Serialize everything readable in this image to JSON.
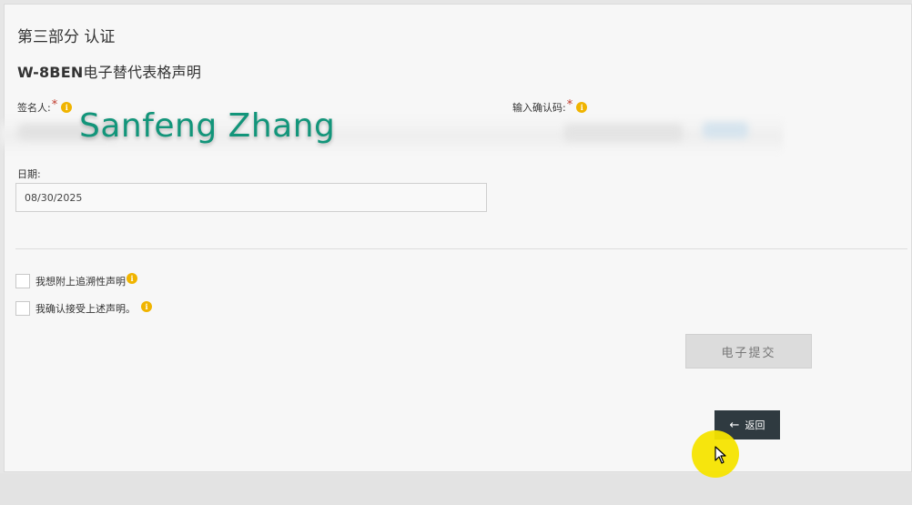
{
  "section": {
    "title": "第三部分 认证"
  },
  "form": {
    "title_prefix": "W-8BEN",
    "title_rest": "电子替代表格声明"
  },
  "signer": {
    "label": "签名人:",
    "required_mark": "*",
    "value": "Sanfeng Zhang"
  },
  "confirm_code": {
    "label": "输入确认码:",
    "required_mark": "*"
  },
  "date": {
    "label": "日期:",
    "value": "08/30/2025"
  },
  "checkboxes": [
    {
      "label": "我想附上追溯性声明"
    },
    {
      "label": "我确认接受上述声明。"
    }
  ],
  "buttons": {
    "submit": "电子提交",
    "back": "返回"
  },
  "icons": {
    "info": "info-icon",
    "back_arrow": "arrow-left-icon",
    "cursor": "mouse-pointer-icon"
  },
  "colors": {
    "signature": "#12957a",
    "info_icon": "#f0b400",
    "back_button": "#2f3a40",
    "required": "#c0392b",
    "click_highlight": "#f5e400"
  }
}
